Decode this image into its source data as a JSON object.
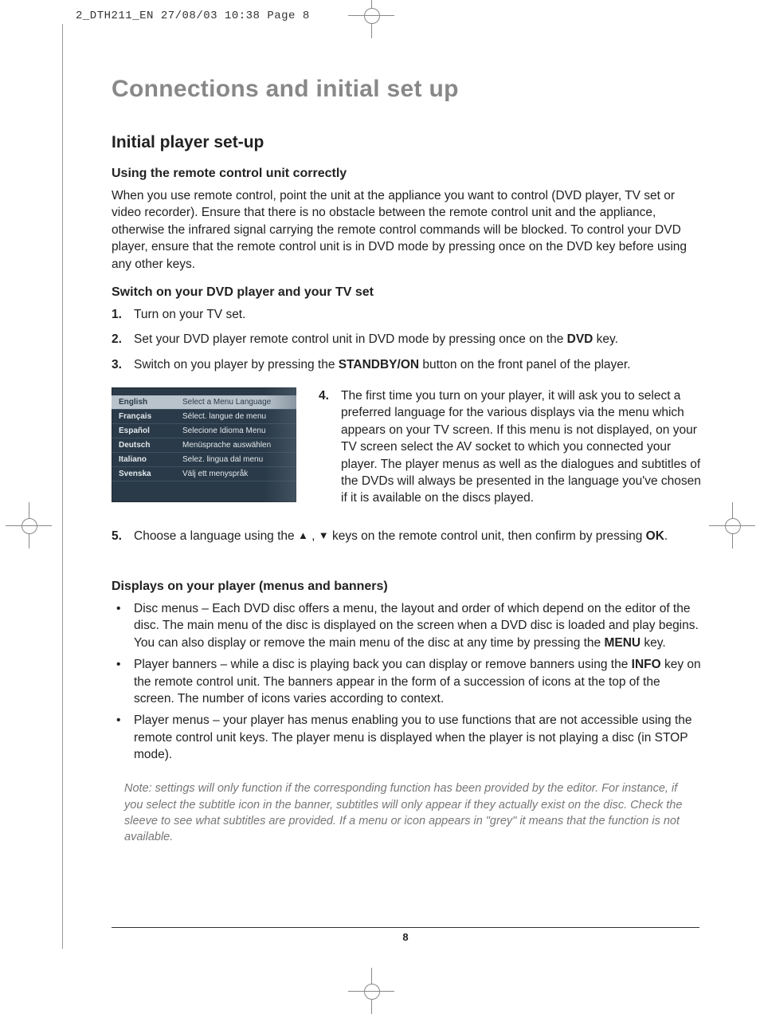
{
  "header": "2_DTH211_EN  27/08/03  10:38  Page 8",
  "title": "Connections and initial set up",
  "section": "Initial player set-up",
  "sub1": "Using the remote control unit correctly",
  "p1": "When you use remote control, point the unit at the appliance you want to control (DVD player, TV set or video recorder). Ensure that there is no obstacle between the remote control unit and the appliance, otherwise the infrared signal carrying the remote control commands will be blocked. To control your DVD player, ensure that the remote control unit is in DVD mode by pressing once on the DVD key before using any other keys.",
  "sub2": "Switch on your DVD player and your TV set",
  "steps": {
    "n1": "1.",
    "t1": "Turn on your TV set.",
    "n2": "2.",
    "t2a": "Set your DVD player remote control unit in DVD mode by pressing once on the ",
    "t2b": "DVD",
    "t2c": " key.",
    "n3": "3.",
    "t3a": "Switch on you player by pressing the ",
    "t3b": "STANDBY/ON",
    "t3c": " button on the front panel of the player.",
    "n4": "4.",
    "t4": "The first time you turn on your player, it will ask you to select a preferred language for the various displays via the menu which appears on your TV screen. If this menu is not displayed, on your TV screen select the AV socket to which you connected your player. The player menus as well as the dialogues and subtitles of the DVDs will always be presented in the language you've chosen if it is available on the discs played.",
    "n5": "5.",
    "t5a": "Choose a language using the ",
    "t5b": " keys on the remote control unit, then confirm by pressing ",
    "t5c": "OK",
    "t5d": "."
  },
  "menu": [
    {
      "lang": "English",
      "desc": "Select a Menu Language"
    },
    {
      "lang": "Français",
      "desc": "Sélect. langue de menu"
    },
    {
      "lang": "Español",
      "desc": "Selecione Idioma Menu"
    },
    {
      "lang": "Deutsch",
      "desc": "Menüsprache auswählen"
    },
    {
      "lang": "Italiano",
      "desc": "Selez. lingua dal menu"
    },
    {
      "lang": "Svenska",
      "desc": "Välj ett menyspråk"
    }
  ],
  "sub3": "Displays on your player (menus and banners)",
  "bullets": {
    "b1a": "Disc menus – Each DVD disc offers a menu, the layout and order of which depend on the editor of the disc. The main menu of the disc is displayed on the screen when a DVD disc is loaded and play begins. You can also display or remove the main menu of the disc at any time by pressing the ",
    "b1b": "MENU",
    "b1c": " key.",
    "b2a": "Player banners – while a disc is playing back you can display or remove banners using the ",
    "b2b": "INFO",
    "b2c": " key on the remote control unit. The banners appear in the form of a succession of icons at the top of the screen. The number of icons varies according to context.",
    "b3": "Player menus – your player has menus enabling you to use functions that are not accessible using the remote control unit keys. The player menu is displayed when the player is not playing a disc (in STOP mode)."
  },
  "note": "Note: settings will only function if the corresponding function has been provided by the editor. For instance, if you select the subtitle icon in the banner, subtitles will only appear if they actually exist on the disc. Check the sleeve to see what subtitles are provided. If a menu or icon appears in \"grey\" it means that the function is not available.",
  "page_number": "8"
}
